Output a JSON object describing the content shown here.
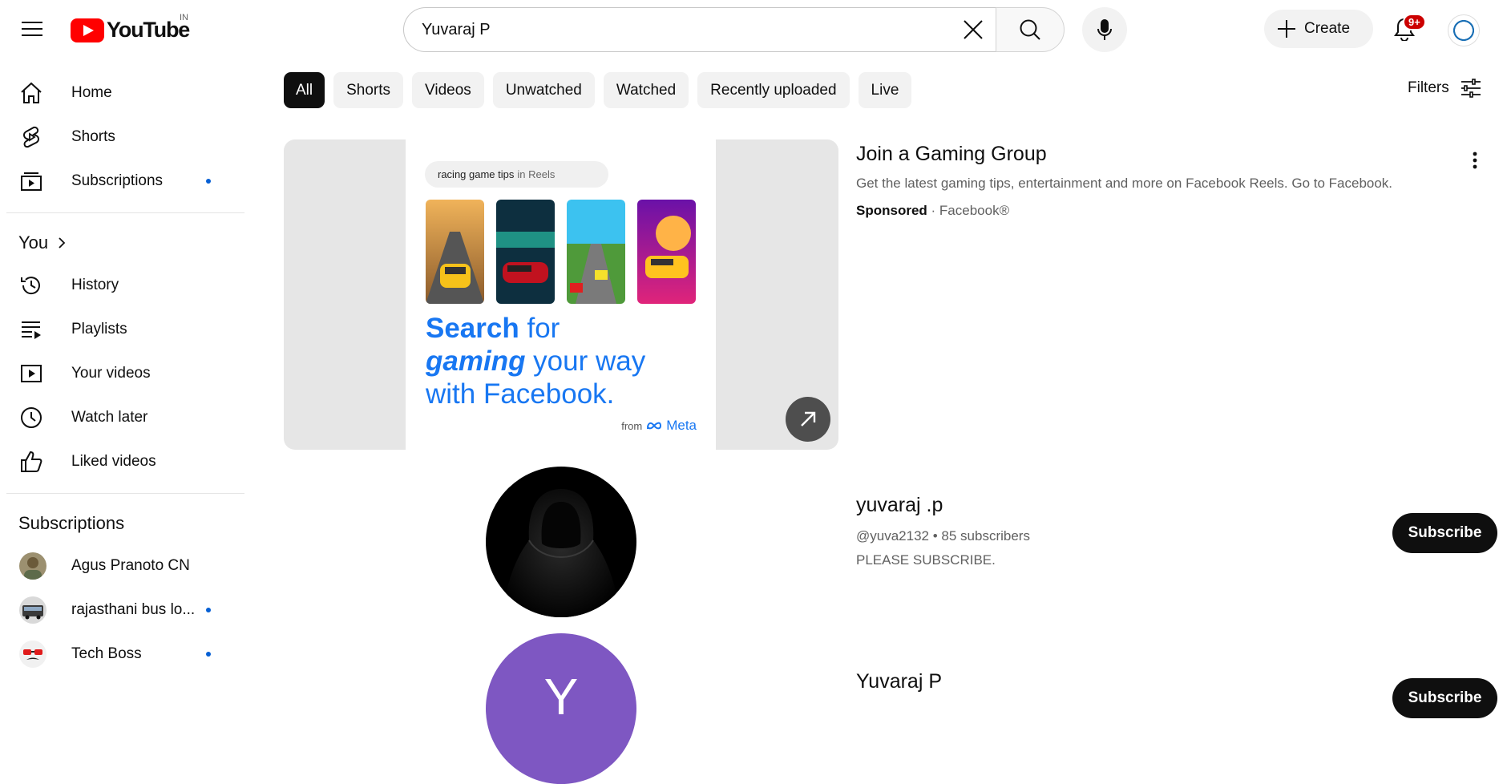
{
  "header": {
    "logo_text": "YouTube",
    "country_code": "IN",
    "search": {
      "value": "Yuvaraj P",
      "placeholder": "Search"
    },
    "create_label": "Create",
    "notification_badge": "9+"
  },
  "sidebar": {
    "main": [
      {
        "label": "Home",
        "icon": "home-icon"
      },
      {
        "label": "Shorts",
        "icon": "shorts-icon"
      },
      {
        "label": "Subscriptions",
        "icon": "subscriptions-icon",
        "dot": true
      }
    ],
    "you_heading": "You",
    "you_items": [
      {
        "label": "History",
        "icon": "history-icon"
      },
      {
        "label": "Playlists",
        "icon": "playlists-icon"
      },
      {
        "label": "Your videos",
        "icon": "your-videos-icon"
      },
      {
        "label": "Watch later",
        "icon": "watch-later-icon"
      },
      {
        "label": "Liked videos",
        "icon": "liked-videos-icon"
      }
    ],
    "subscriptions_heading": "Subscriptions",
    "subscriptions": [
      {
        "label": "Agus Pranoto CN",
        "dot": false
      },
      {
        "label": "rajasthani bus lo...",
        "dot": true
      },
      {
        "label": "Tech Boss",
        "dot": true
      }
    ]
  },
  "chips": [
    "All",
    "Shorts",
    "Videos",
    "Unwatched",
    "Watched",
    "Recently uploaded",
    "Live"
  ],
  "filters_label": "Filters",
  "ad": {
    "pill_query": "racing game tips",
    "pill_suffix": "in Reels",
    "headline_1a": "Search",
    "headline_1b": " for",
    "headline_2a": "gaming",
    "headline_2b": " your way",
    "headline_3": "with Facebook.",
    "from_label": "from",
    "meta_label": "Meta",
    "title": "Join a Gaming Group",
    "description": "Get the latest gaming tips, entertainment and more on Facebook Reels. Go to Facebook.",
    "sponsored_label": "Sponsored",
    "advertiser": "Facebook®"
  },
  "channels": [
    {
      "name": "yuvaraj .p",
      "handle": "@yuva2132",
      "subscribers": "85 subscribers",
      "description": "PLEASE SUBSCRIBE.",
      "subscribe_label": "Subscribe"
    },
    {
      "name": "Yuvaraj P",
      "avatar_letter": "Y",
      "avatar_color": "#7e57c2",
      "subscribe_label": "Subscribe"
    }
  ],
  "colors": {
    "brand_red": "#ff0000",
    "link_blue": "#065fd4",
    "facebook_blue": "#1877f2"
  }
}
